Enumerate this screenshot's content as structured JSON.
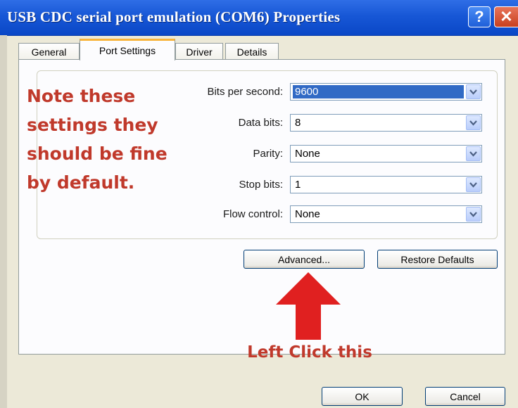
{
  "window": {
    "title": "USB CDC serial port emulation (COM6) Properties",
    "help_label": "?",
    "close_label": "✕"
  },
  "tabs": [
    {
      "label": "General",
      "active": false
    },
    {
      "label": "Port Settings",
      "active": true
    },
    {
      "label": "Driver",
      "active": false
    },
    {
      "label": "Details",
      "active": false
    }
  ],
  "note": {
    "lines": [
      "Note these",
      "settings they",
      "should be fine",
      "by default."
    ],
    "color": "#c0392b"
  },
  "settings": {
    "bits_per_second": {
      "label": "Bits per second:",
      "value": "9600"
    },
    "data_bits": {
      "label": "Data bits:",
      "value": "8"
    },
    "parity": {
      "label": "Parity:",
      "value": "None"
    },
    "stop_bits": {
      "label": "Stop bits:",
      "value": "1"
    },
    "flow_control": {
      "label": "Flow control:",
      "value": "None"
    }
  },
  "buttons": {
    "advanced": "Advanced...",
    "restore_defaults": "Restore Defaults",
    "ok": "OK",
    "cancel": "Cancel"
  },
  "annotation": {
    "text": "Left Click this",
    "arrow_icon": "arrow-up-icon",
    "color": "#e02020"
  }
}
